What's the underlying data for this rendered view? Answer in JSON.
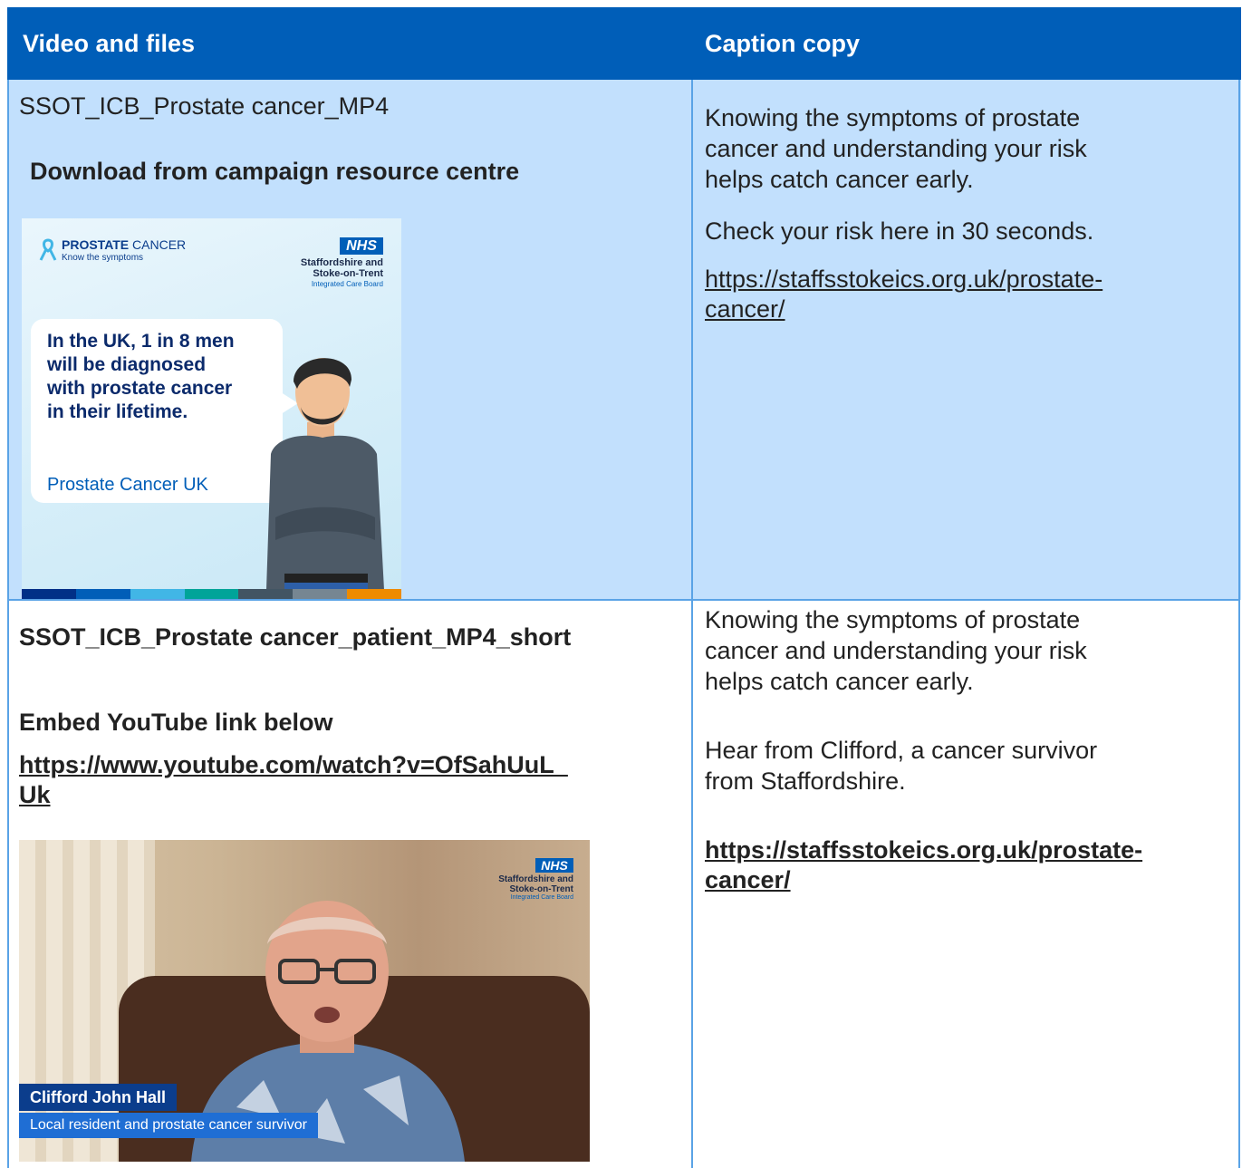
{
  "header": {
    "col1": "Video and files",
    "col2": "Caption copy"
  },
  "row1": {
    "file_name": "SSOT_ICB_Prostate cancer_MP4",
    "download": "Download from campaign resource centre",
    "caption_lines": [
      "Knowing the symptoms of prostate",
      "cancer and understanding your risk",
      "helps catch cancer early."
    ],
    "check": "Check your risk here in 30 seconds.",
    "link_lines": [
      "https://staffsstokeics.org.uk/prostate-",
      "cancer/"
    ],
    "poster": {
      "brand": "PROSTATE",
      "brand_rest": " CANCER",
      "brand_sub": "Know the symptoms",
      "nhs": "NHS",
      "org_line1": "Staffordshire and",
      "org_line2": "Stoke-on-Trent",
      "org_sub": "Integrated Care Board",
      "bubble_lines": [
        "In the UK, 1 in 8 men",
        "will be diagnosed",
        "with prostate cancer",
        "in their lifetime."
      ],
      "bubble_source": "Prostate Cancer UK",
      "stripe_colors": [
        "#003087",
        "#005eb8",
        "#41b6e6",
        "#00a499",
        "#425563",
        "#768692",
        "#ed8b00"
      ]
    }
  },
  "row2": {
    "file_name": "SSOT_ICB_Prostate cancer_patient_MP4_short",
    "embed": "Embed YouTube link below",
    "youtube_lines": [
      "https://www.youtube.com/watch?v=OfSahUuL_",
      "Uk"
    ],
    "caption_lines": [
      "Knowing the symptoms of prostate",
      "cancer and understanding your risk",
      "helps catch cancer early."
    ],
    "hear_lines": [
      "Hear from Clifford, a cancer survivor",
      "from Staffordshire."
    ],
    "link_lines": [
      "https://staffsstokeics.org.uk/prostate-",
      "cancer/"
    ],
    "photo": {
      "nhs": "NHS",
      "org_line1": "Staffordshire and",
      "org_line2": "Stoke-on-Trent",
      "org_sub": "Integrated Care Board",
      "name": "Clifford John Hall",
      "role": "Local resident and prostate cancer survivor"
    }
  }
}
